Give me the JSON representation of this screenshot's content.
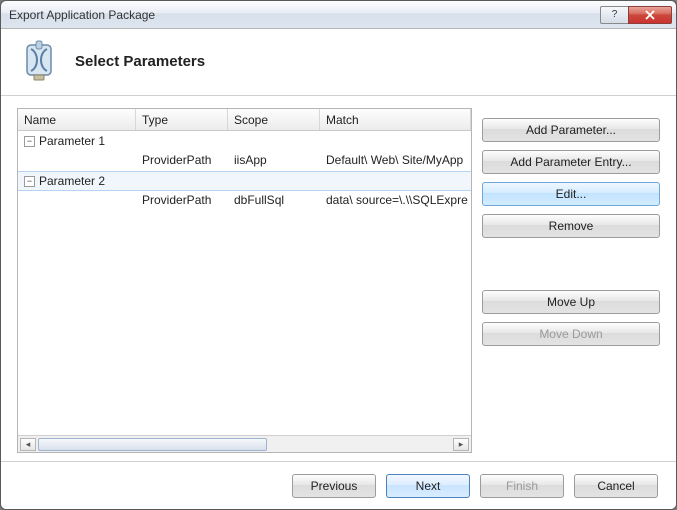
{
  "window": {
    "title": "Export Application Package"
  },
  "page": {
    "title": "Select Parameters"
  },
  "grid": {
    "columns": {
      "name": "Name",
      "type": "Type",
      "scope": "Scope",
      "match": "Match"
    },
    "rows": [
      {
        "label": "Parameter 1",
        "expanded": true,
        "child": {
          "type": "ProviderPath",
          "scope": "iisApp",
          "match": "Default\\ Web\\ Site/MyApp"
        }
      },
      {
        "label": "Parameter 2",
        "expanded": true,
        "selected": true,
        "child": {
          "type": "ProviderPath",
          "scope": "dbFullSql",
          "match": "data\\ source=\\.\\\\SQLExpre"
        }
      }
    ]
  },
  "side": {
    "add_param": "Add Parameter...",
    "add_entry": "Add Parameter Entry...",
    "edit": "Edit...",
    "remove": "Remove",
    "move_up": "Move Up",
    "move_down": "Move Down"
  },
  "footer": {
    "previous": "Previous",
    "next": "Next",
    "finish": "Finish",
    "cancel": "Cancel"
  },
  "glyphs": {
    "minus": "−",
    "left": "◂",
    "right": "▸",
    "help": "?"
  }
}
